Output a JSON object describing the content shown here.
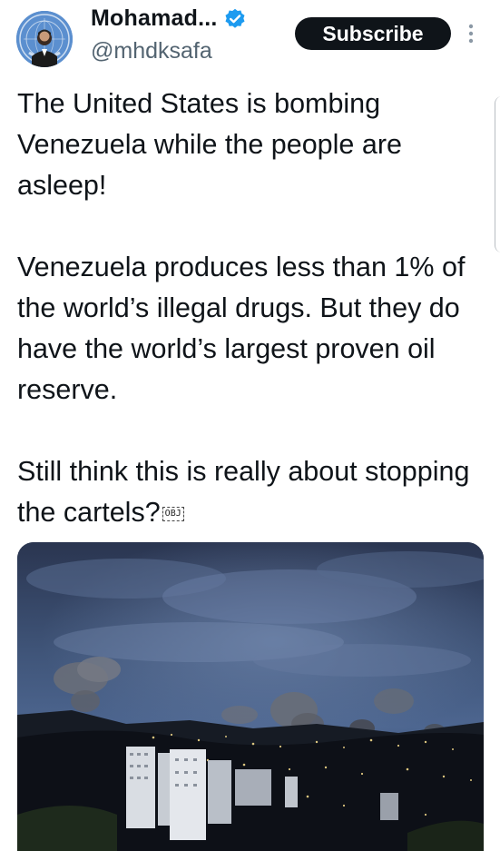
{
  "header": {
    "display_name": "Mohamad...",
    "handle": "@mhdksafa",
    "subscribe_label": "Subscribe",
    "verified_color": "#1d9bf0",
    "avatar_icon": "un-emblem-avatar",
    "more_icon": "vertical-ellipsis-icon"
  },
  "tweet": {
    "paragraph_1": "The United States is bombing Venezuela while the people are asleep!",
    "paragraph_2": "Venezuela produces less than 1% of the world’s illegal drugs. But they do have the world’s largest proven oil reserve.",
    "paragraph_3": "Still think this is really about stopping the cartels?",
    "trailing_glyph": "OBJ"
  },
  "media": {
    "description_icon": "night-city-smoke-photo"
  },
  "colors": {
    "text": "#0f1419",
    "secondary": "#536471",
    "button_bg": "#0f1419"
  }
}
